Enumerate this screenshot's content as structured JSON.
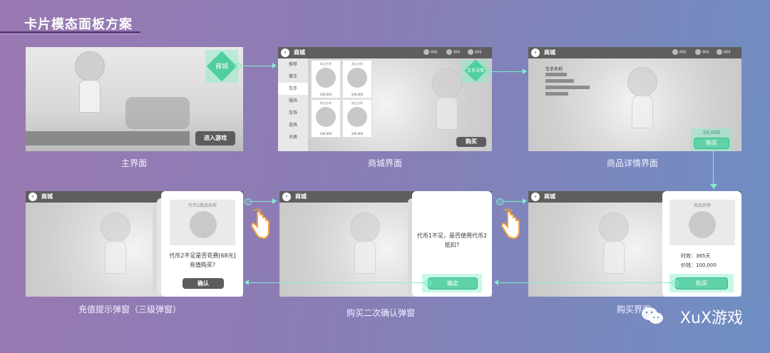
{
  "page_title": "卡片模态面板方案",
  "screens": {
    "main": {
      "label": "主界面",
      "shop_diamond": "商城",
      "enter_button": "进入游戏"
    },
    "shop": {
      "label": "商城界面",
      "topbar_title": "商城",
      "currency": [
        "666",
        "666",
        "666"
      ],
      "sidebar": [
        "推荐",
        "赛车",
        "车手",
        "服饰",
        "车饰",
        "道具",
        "兑换"
      ],
      "active_tab": "车手",
      "cards": [
        {
          "name": "商品名称",
          "price": "100,000"
        },
        {
          "name": "商品名称",
          "price": "100,000"
        },
        {
          "name": "商品名称",
          "price": "100,000"
        },
        {
          "name": "商品名称",
          "price": "100,000"
        }
      ],
      "diamond": "车手详情",
      "buy_button": "购买"
    },
    "detail": {
      "label": "商品详情界面",
      "topbar_title": "商城",
      "currency": [
        "666",
        "666",
        "666"
      ],
      "driver_name": "车手名称",
      "price": "20,000",
      "buy_button": "购买"
    },
    "purchase": {
      "label": "购买界面",
      "topbar_title": "商城",
      "product_name": "商品名称",
      "duration": "时效：365天",
      "price": "价钱：100,000",
      "buy_button": "购买"
    },
    "confirm": {
      "label": "购买二次确认弹窗",
      "message_line1": "代币1不足，是否使用代币2",
      "message_line2": "抵扣?",
      "confirm_button": "确定"
    },
    "recharge": {
      "label": "充值提示弹窗（三级弹窗）",
      "topbar_title": "商城",
      "product_name": "代币2商品名称",
      "message_line1": "代币2不足是否花费[68元]",
      "message_line2": "充值购买?",
      "confirm_button": "确认"
    }
  },
  "watermark": "XuX游戏",
  "colors": {
    "accent": "#7ff0d0",
    "button_green": "#5fd3a7",
    "button_dark": "#5c5c5c"
  }
}
